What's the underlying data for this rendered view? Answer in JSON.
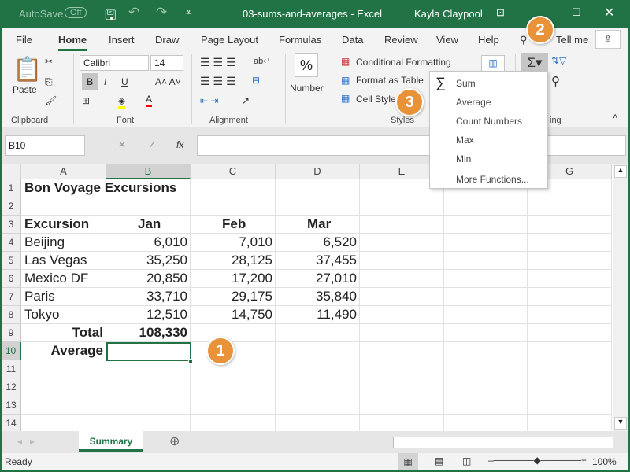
{
  "titlebar": {
    "autosave": "AutoSave",
    "autosave_state": "Off",
    "title": "03-sums-and-averages  -  Excel",
    "user": "Kayla Claypool"
  },
  "tabs": [
    "File",
    "Home",
    "Insert",
    "Draw",
    "Page Layout",
    "Formulas",
    "Data",
    "Review",
    "View",
    "Help",
    "Tell me"
  ],
  "ribbon": {
    "paste": "Paste",
    "font_name": "Calibri",
    "font_size": "14",
    "bold": "B",
    "italic": "I",
    "underline": "U",
    "number": "Number",
    "percent": "%",
    "conditional_formatting": "Conditional Formatting",
    "format_as_table": "Format as Table",
    "cell_styles": "Cell Styles",
    "groups": [
      "Clipboard",
      "Font",
      "Alignment",
      "Styles",
      "Editing"
    ],
    "editing_partial": "ing"
  },
  "autosum_menu": {
    "items": [
      "Sum",
      "Average",
      "Count Numbers",
      "Max",
      "Min",
      "More Functions..."
    ]
  },
  "formula_bar": {
    "name_box": "B10",
    "fx": "fx",
    "value": ""
  },
  "columns": [
    "A",
    "B",
    "C",
    "D",
    "E",
    "F",
    "G"
  ],
  "rows": [
    "1",
    "2",
    "3",
    "4",
    "5",
    "6",
    "7",
    "8",
    "9",
    "10",
    "11",
    "12",
    "13",
    "14"
  ],
  "cells": {
    "title": "Bon Voyage Excursions",
    "headers": [
      "Excursion",
      "Jan",
      "Feb",
      "Mar"
    ],
    "data": [
      [
        "Beijing",
        "6,010",
        "7,010",
        "6,520"
      ],
      [
        "Las Vegas",
        "35,250",
        "28,125",
        "37,455"
      ],
      [
        "Mexico DF",
        "20,850",
        "17,200",
        "27,010"
      ],
      [
        "Paris",
        "33,710",
        "29,175",
        "35,840"
      ],
      [
        "Tokyo",
        "12,510",
        "14,750",
        "11,490"
      ]
    ],
    "total_label": "Total",
    "total_jan": "108,330",
    "average_label": "Average"
  },
  "sheet_tab": "Summary",
  "status": {
    "ready": "Ready",
    "zoom": "100%"
  },
  "callouts": [
    "1",
    "2",
    "3"
  ],
  "colors": {
    "brand": "#217346",
    "callout": "#e8933a"
  }
}
